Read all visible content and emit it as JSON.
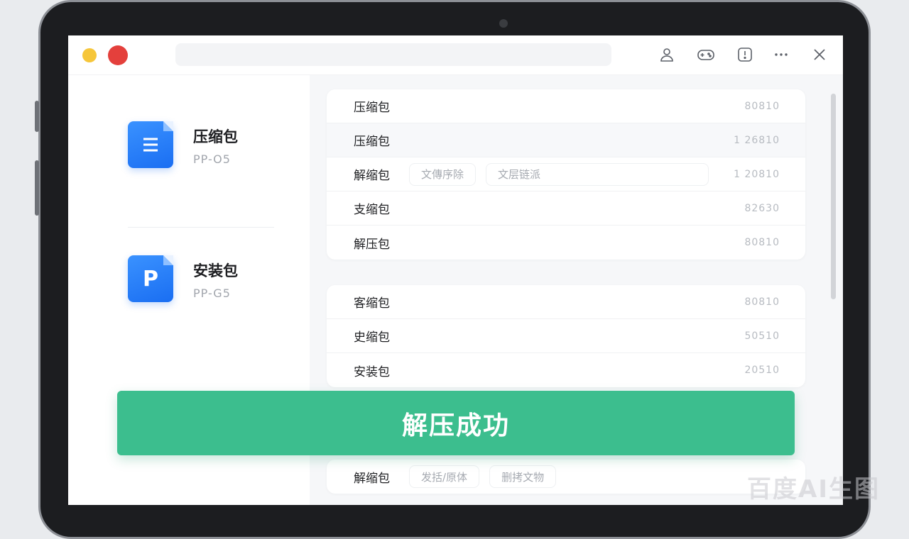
{
  "sidebar": {
    "files": [
      {
        "name": "压缩包",
        "code": "PP-O5",
        "glyph": "☰",
        "color": "#1a6ef2"
      },
      {
        "name": "安装包",
        "code": "PP-G5",
        "glyph": "P",
        "color": "#1a6ef2"
      }
    ]
  },
  "list": {
    "card1": [
      {
        "label": "压缩包",
        "value": "80810",
        "tags": []
      },
      {
        "label": "压缩包",
        "value": "1 26810",
        "tags": []
      },
      {
        "label": "解缩包",
        "value": "1 20810",
        "tags": [
          "文傳序除",
          "文层链派"
        ]
      },
      {
        "label": "支缩包",
        "value": "82630",
        "tags": []
      },
      {
        "label": "解压包",
        "value": "80810",
        "tags": []
      }
    ],
    "card2": [
      {
        "label": "客缩包",
        "value": "80810",
        "tags": []
      },
      {
        "label": "史缩包",
        "value": "50510",
        "tags": []
      },
      {
        "label": "安装包",
        "value": "20510",
        "tags": []
      }
    ],
    "bottom_row": {
      "label": "解缩包",
      "tags": [
        "发括/原体",
        "删拷文物"
      ]
    }
  },
  "banner": {
    "text": "解压成功",
    "color": "#3cbe8e"
  },
  "watermark": "百度AI生图",
  "toolbar_icons": [
    "user-icon",
    "gamepad-icon",
    "info-icon",
    "more-icon",
    "close-icon"
  ]
}
